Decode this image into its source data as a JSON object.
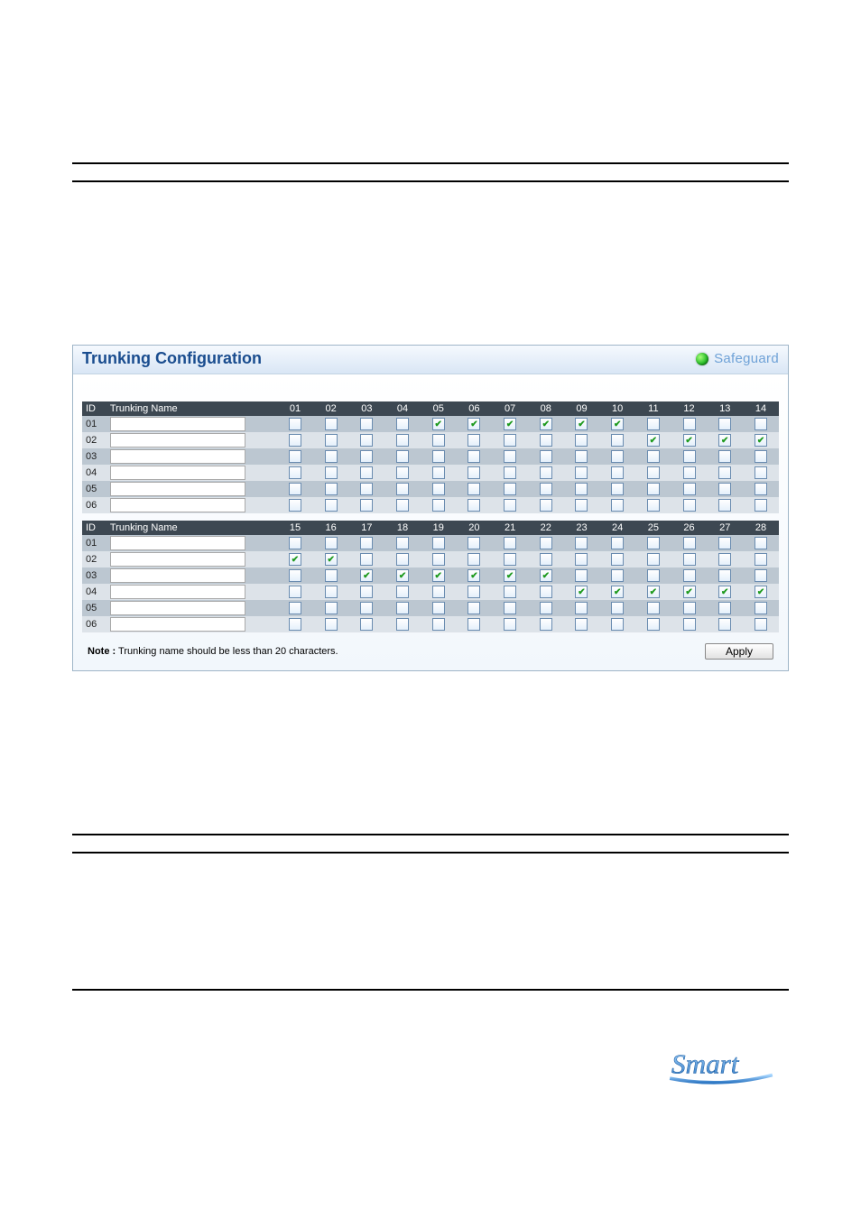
{
  "panel": {
    "title": "Trunking Configuration",
    "safeguard_label": "Safeguard"
  },
  "tables": [
    {
      "headers": {
        "id": "ID",
        "name": "Trunking Name"
      },
      "ports": [
        "01",
        "02",
        "03",
        "04",
        "05",
        "06",
        "07",
        "08",
        "09",
        "10",
        "11",
        "12",
        "13",
        "14"
      ],
      "rows": [
        {
          "id": "01",
          "name": "",
          "checks": [
            false,
            false,
            false,
            false,
            true,
            true,
            true,
            true,
            true,
            true,
            false,
            false,
            false,
            false
          ]
        },
        {
          "id": "02",
          "name": "",
          "checks": [
            false,
            false,
            false,
            false,
            false,
            false,
            false,
            false,
            false,
            false,
            true,
            true,
            true,
            true
          ]
        },
        {
          "id": "03",
          "name": "",
          "checks": [
            false,
            false,
            false,
            false,
            false,
            false,
            false,
            false,
            false,
            false,
            false,
            false,
            false,
            false
          ]
        },
        {
          "id": "04",
          "name": "",
          "checks": [
            false,
            false,
            false,
            false,
            false,
            false,
            false,
            false,
            false,
            false,
            false,
            false,
            false,
            false
          ]
        },
        {
          "id": "05",
          "name": "",
          "checks": [
            false,
            false,
            false,
            false,
            false,
            false,
            false,
            false,
            false,
            false,
            false,
            false,
            false,
            false
          ]
        },
        {
          "id": "06",
          "name": "",
          "checks": [
            false,
            false,
            false,
            false,
            false,
            false,
            false,
            false,
            false,
            false,
            false,
            false,
            false,
            false
          ]
        }
      ]
    },
    {
      "headers": {
        "id": "ID",
        "name": "Trunking Name"
      },
      "ports": [
        "15",
        "16",
        "17",
        "18",
        "19",
        "20",
        "21",
        "22",
        "23",
        "24",
        "25",
        "26",
        "27",
        "28"
      ],
      "rows": [
        {
          "id": "01",
          "name": "",
          "checks": [
            false,
            false,
            false,
            false,
            false,
            false,
            false,
            false,
            false,
            false,
            false,
            false,
            false,
            false
          ]
        },
        {
          "id": "02",
          "name": "",
          "checks": [
            true,
            true,
            false,
            false,
            false,
            false,
            false,
            false,
            false,
            false,
            false,
            false,
            false,
            false
          ]
        },
        {
          "id": "03",
          "name": "",
          "checks": [
            false,
            false,
            true,
            true,
            true,
            true,
            true,
            true,
            false,
            false,
            false,
            false,
            false,
            false
          ]
        },
        {
          "id": "04",
          "name": "",
          "checks": [
            false,
            false,
            false,
            false,
            false,
            false,
            false,
            false,
            true,
            true,
            true,
            true,
            true,
            true
          ]
        },
        {
          "id": "05",
          "name": "",
          "checks": [
            false,
            false,
            false,
            false,
            false,
            false,
            false,
            false,
            false,
            false,
            false,
            false,
            false,
            false
          ]
        },
        {
          "id": "06",
          "name": "",
          "checks": [
            false,
            false,
            false,
            false,
            false,
            false,
            false,
            false,
            false,
            false,
            false,
            false,
            false,
            false
          ]
        }
      ]
    }
  ],
  "footer": {
    "note_label": "Note :",
    "note_text": " Trunking name should be less than 20 characters.",
    "apply_label": "Apply"
  },
  "logo": {
    "text": "Smart"
  }
}
